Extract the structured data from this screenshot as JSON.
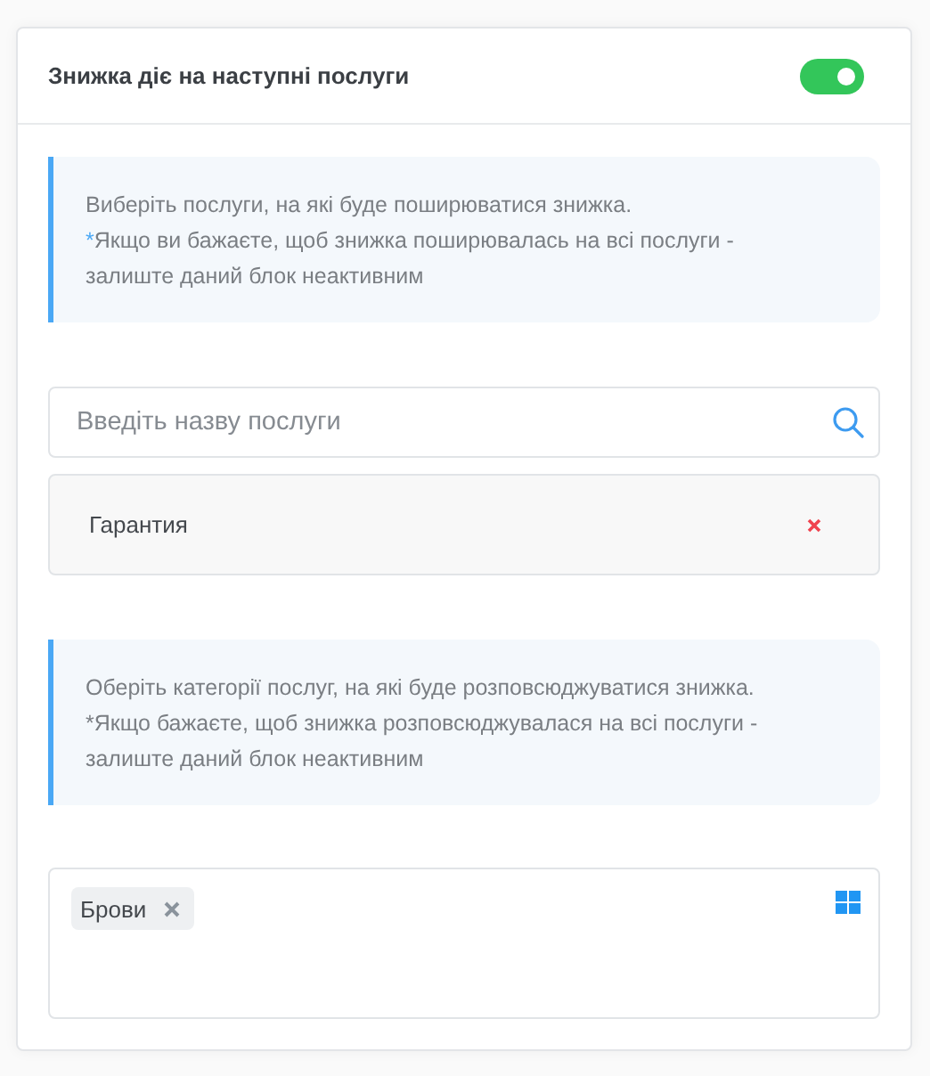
{
  "panel": {
    "title": "Знижка діє на наступні послуги",
    "enabled": true
  },
  "services_info": {
    "text": "Виберіть послуги, на які буде поширюватися знижка.",
    "note_mark": "*",
    "mark_highlight": true,
    "note": "Якщо ви бажаєте, щоб знижка поширювалась на всі послуги - залиште даний блок неактивним"
  },
  "service_search": {
    "placeholder": "Введіть назву послуги"
  },
  "selected_services": [
    {
      "name": "Гарантия"
    }
  ],
  "categories_info": {
    "text": "Оберіть категорії послуг, на які буде розповсюджуватися знижка.",
    "note_mark": "*",
    "mark_highlight": false,
    "note": "Якщо бажаєте, щоб знижка розповсюджувалася на всі послуги - залиште даний блок неактивним"
  },
  "category_tags": [
    {
      "label": "Брови"
    }
  ]
}
